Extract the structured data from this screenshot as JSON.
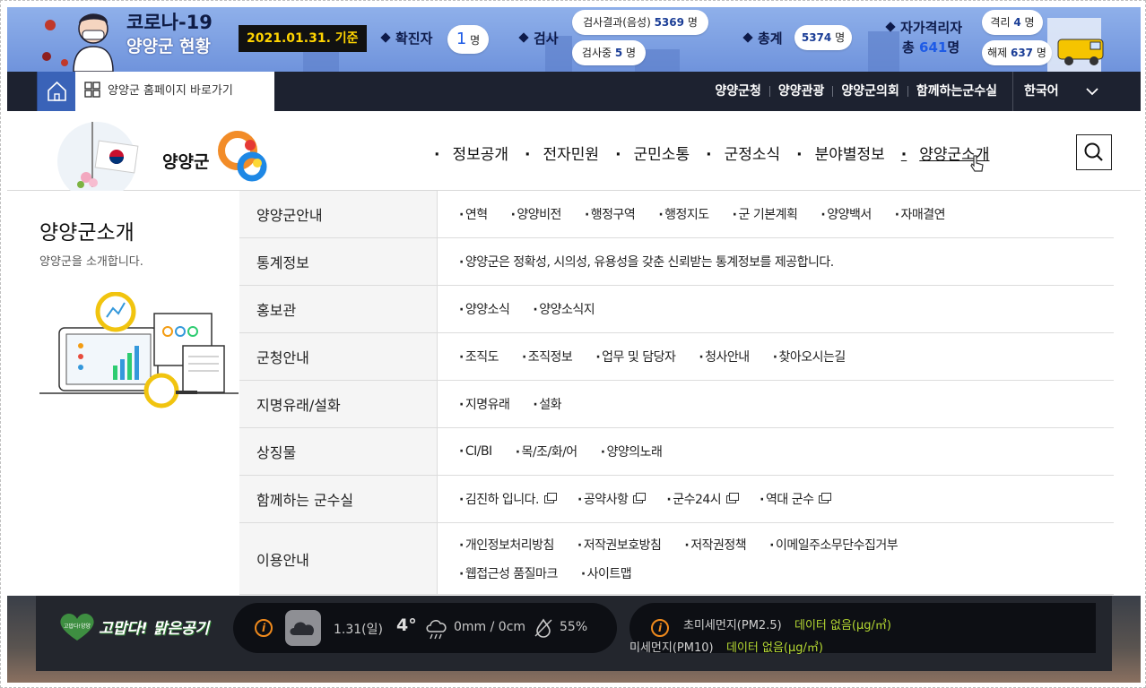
{
  "covid": {
    "title": "코로나-19",
    "subtitle": "양양군 현황",
    "date": "2021.01.31. 기준",
    "confirmed_label": "확진자",
    "confirmed_value": "1",
    "confirmed_unit": "명",
    "test_label": "검사",
    "test_negative_label": "검사결과(음성)",
    "test_negative_value": "5369",
    "test_pending_label": "검사중",
    "test_pending_value": "5",
    "total_label": "총계",
    "total_value": "5374",
    "quarantine_label": "자가격리자",
    "quarantine_total_prefix": "총",
    "quarantine_total_value": "641",
    "quarantine_total_unit": "명",
    "isolated_label": "격리",
    "isolated_value": "4",
    "released_label": "해제",
    "released_value": "637",
    "unit": "명"
  },
  "topbar": {
    "shortcut_label": "양양군 홈페이지 바로가기",
    "links": [
      "양양군청",
      "양양관광",
      "양양군의회",
      "함께하는군수실"
    ],
    "language": "한국어"
  },
  "header": {
    "logo_text": "양양군",
    "gnb": [
      "정보공개",
      "전자민원",
      "군민소통",
      "군정소식",
      "분야별정보",
      "양양군소개"
    ],
    "active_gnb": "양양군소개"
  },
  "mega": {
    "title": "양양군소개",
    "description": "양양군을 소개합니다.",
    "rows": [
      {
        "category": "양양군안내",
        "links": [
          "연혁",
          "양양비전",
          "행정구역",
          "행정지도",
          "군 기본계획",
          "양양백서",
          "자매결연"
        ]
      },
      {
        "category": "통계정보",
        "links": [
          "양양군은 정확성, 시의성, 유용성을 갖춘 신뢰받는 통계정보를 제공합니다."
        ]
      },
      {
        "category": "홍보관",
        "links": [
          "양양소식",
          "양양소식지"
        ]
      },
      {
        "category": "군청안내",
        "links": [
          "조직도",
          "조직정보",
          "업무 및 담당자",
          "청사안내",
          "찾아오시는길"
        ]
      },
      {
        "category": "지명유래/설화",
        "links": [
          "지명유래",
          "설화"
        ]
      },
      {
        "category": "상징물",
        "links": [
          "CI/BI",
          "목/조/화/어",
          "양양의노래"
        ]
      },
      {
        "category": "함께하는 군수실",
        "links": [
          "김진하 입니다.",
          "공약사항",
          "군수24시",
          "역대 군수"
        ]
      },
      {
        "category": "이용안내",
        "links": [
          "개인정보처리방침",
          "저작권보호방침",
          "저작권정책",
          "이메일주소무단수집거부",
          "웹접근성 품질마크",
          "사이트맵"
        ]
      }
    ]
  },
  "bottom": {
    "air_logo_badge": "고맙다!양양",
    "air_logo_text": "고맙다! 맑은공기",
    "weather_date": "1.31(일)",
    "weather_temp": "4°",
    "weather_rain": "0mm / 0cm",
    "weather_humidity": "55%",
    "pm25_label": "초미세먼지(PM2.5)",
    "pm25_value": "데이터 없음(μg/㎥)",
    "pm10_label": "미세먼지(PM10)",
    "pm10_value": "데이터 없음(μg/㎥)"
  },
  "colors": {
    "covid_bg": "#7b9de2",
    "nav_dark": "#1d2230",
    "home_blue": "#3a63b8",
    "date_yellow": "#ffd400",
    "pm_green": "#b5d832",
    "info_orange": "#f08a1c"
  }
}
